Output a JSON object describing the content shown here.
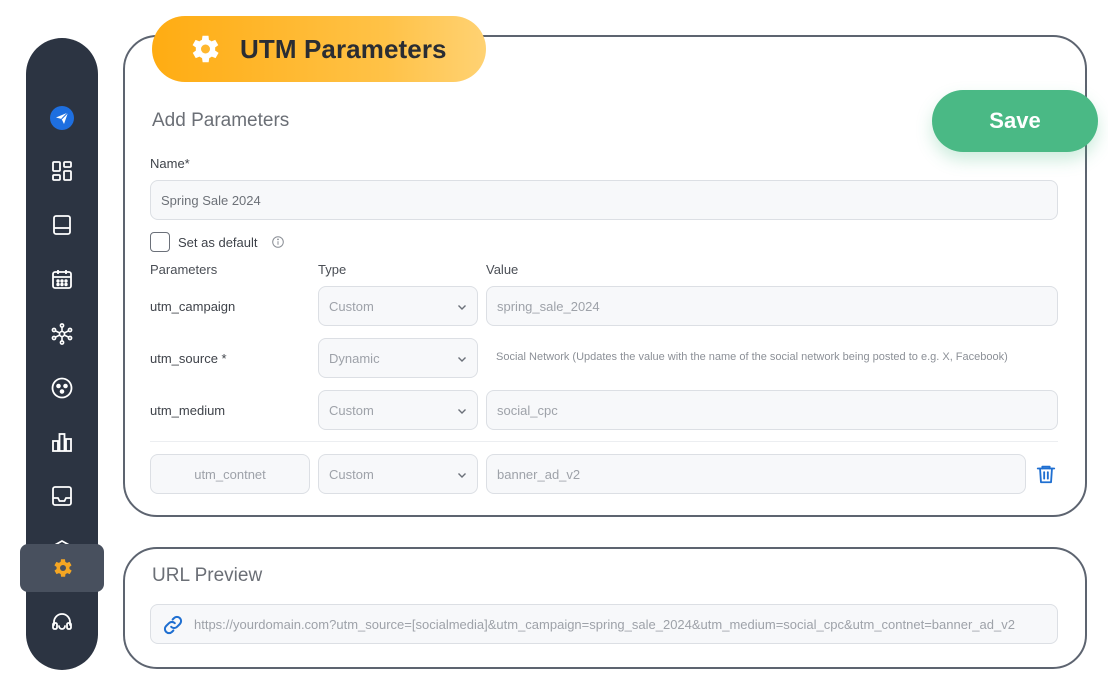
{
  "header": {
    "title": "UTM Parameters",
    "title_icon": "gear-icon",
    "save_label": "Save"
  },
  "sidebar": {
    "items": [
      {
        "icon": "paper-plane-icon",
        "active": false
      },
      {
        "icon": "dashboard-grid-icon",
        "active": false
      },
      {
        "icon": "book-icon",
        "active": false
      },
      {
        "icon": "calendar-icon",
        "active": false
      },
      {
        "icon": "network-icon",
        "active": false
      },
      {
        "icon": "emoji-circle-icon",
        "active": false
      },
      {
        "icon": "bar-chart-icon",
        "active": false
      },
      {
        "icon": "inbox-tray-icon",
        "active": false
      },
      {
        "icon": "layers-icon",
        "active": false
      },
      {
        "icon": "gear-icon",
        "active": true
      },
      {
        "icon": "headset-icon",
        "active": false
      }
    ]
  },
  "form": {
    "section_title": "Add Parameters",
    "name_label": "Name*",
    "name_value": "Spring Sale 2024",
    "default_checkbox_label": "Set as default",
    "default_checked": false,
    "columns": {
      "parameters": "Parameters",
      "type": "Type",
      "value": "Value"
    },
    "rows": [
      {
        "param": "utm_campaign",
        "type": "Custom",
        "value": "spring_sale_2024"
      },
      {
        "param": "utm_source *",
        "type": "Dynamic",
        "value": "Social Network (Updates the value with the name of the social network being posted to e.g. X, Facebook)"
      },
      {
        "param": "utm_medium",
        "type": "Custom",
        "value": "social_cpc"
      }
    ],
    "custom_row": {
      "param": "utm_contnet",
      "type": "Custom",
      "value": "banner_ad_v2"
    }
  },
  "preview": {
    "section_title": "URL Preview",
    "url": "https://yourdomain.com?utm_source=[socialmedia]&utm_campaign=spring_sale_2024&utm_medium=social_cpc&utm_contnet=banner_ad_v2"
  },
  "colors": {
    "sidebar_bg": "#2c3442",
    "accent_orange": "#ffac12",
    "save_green": "#4ab985",
    "link_blue": "#1f6fd1"
  }
}
